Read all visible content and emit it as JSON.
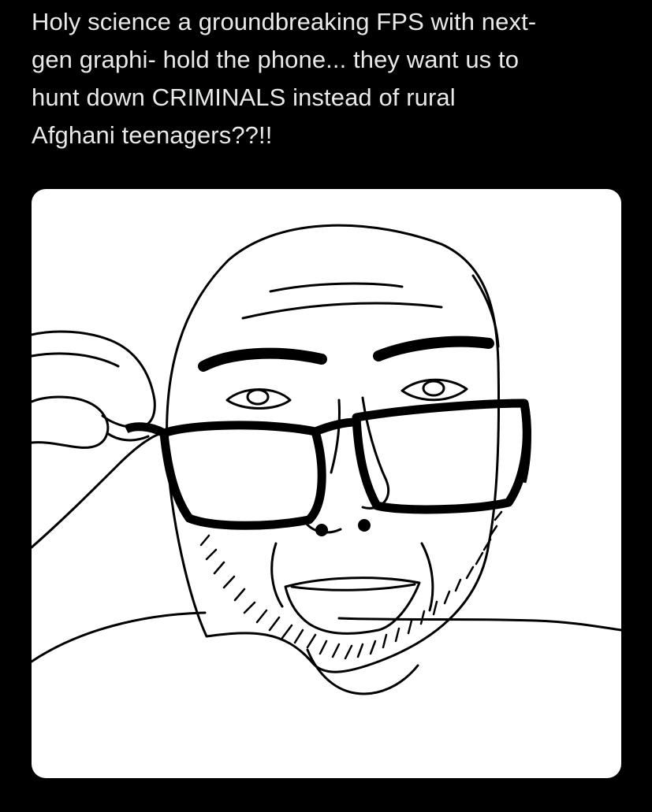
{
  "tweet": {
    "text": "Holy science a groundbreaking FPS with next-\ngen graphi- hold the phone... they want us to\nhunt down CRIMINALS instead of rural\nAfghani teenagers??!!",
    "background_color": "#000000",
    "text_color": "#e7e9ea"
  },
  "media": {
    "type": "image",
    "subject": "wojak-adjusting-glasses-drawing",
    "background_color": "#ffffff"
  }
}
